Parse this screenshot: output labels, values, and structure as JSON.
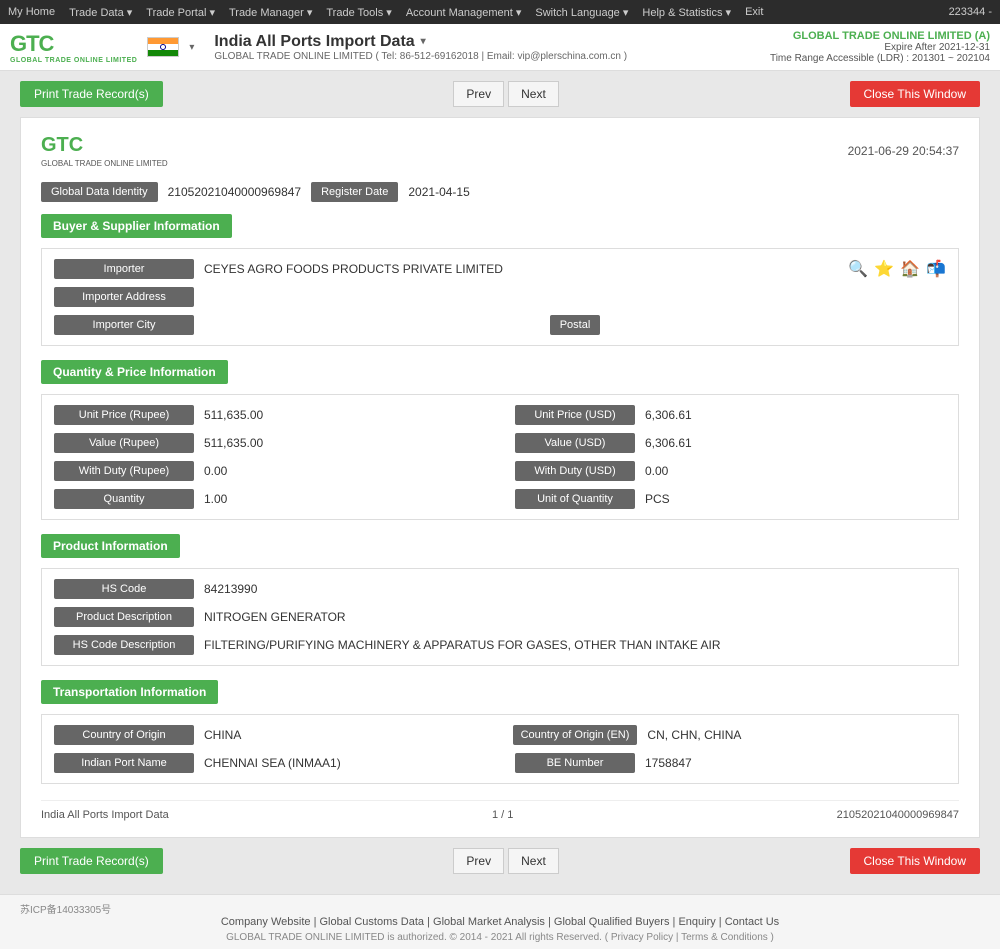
{
  "topnav": {
    "items": [
      "My Home",
      "Trade Data",
      "Trade Portal",
      "Trade Manager",
      "Trade Tools",
      "Account Management",
      "Switch Language",
      "Help & Statistics",
      "Exit"
    ],
    "account_id": "223344 -"
  },
  "header": {
    "title": "India All Ports Import Data",
    "company_info": "GLOBAL TRADE ONLINE LIMITED ( Tel: 86-512-69162018 | Email: vip@plerschina.com.cn )",
    "right_company": "GLOBAL TRADE ONLINE LIMITED (A)",
    "expire": "Expire After 2021-12-31",
    "time_range": "Time Range Accessible (LDR) : 201301 ~ 202104"
  },
  "toolbar_top": {
    "print_label": "Print Trade Record(s)",
    "prev_label": "Prev",
    "next_label": "Next",
    "close_label": "Close This Window"
  },
  "record": {
    "datetime": "2021-06-29 20:54:37",
    "global_data_identity_label": "Global Data Identity",
    "global_data_identity_value": "21052021040000969847",
    "register_date_label": "Register Date",
    "register_date_value": "2021-04-15",
    "sections": {
      "buyer_supplier": {
        "title": "Buyer & Supplier Information",
        "importer_label": "Importer",
        "importer_value": "CEYES AGRO FOODS PRODUCTS PRIVATE LIMITED",
        "importer_address_label": "Importer Address",
        "importer_address_value": "",
        "importer_city_label": "Importer City",
        "importer_city_value": "",
        "postal_label": "Postal",
        "postal_value": ""
      },
      "quantity_price": {
        "title": "Quantity & Price Information",
        "fields": [
          {
            "label": "Unit Price (Rupee)",
            "value": "511,635.00",
            "label2": "Unit Price (USD)",
            "value2": "6,306.61"
          },
          {
            "label": "Value (Rupee)",
            "value": "511,635.00",
            "label2": "Value (USD)",
            "value2": "6,306.61"
          },
          {
            "label": "With Duty (Rupee)",
            "value": "0.00",
            "label2": "With Duty (USD)",
            "value2": "0.00"
          },
          {
            "label": "Quantity",
            "value": "1.00",
            "label2": "Unit of Quantity",
            "value2": "PCS"
          }
        ]
      },
      "product": {
        "title": "Product Information",
        "hs_code_label": "HS Code",
        "hs_code_value": "84213990",
        "product_desc_label": "Product Description",
        "product_desc_value": "NITROGEN GENERATOR",
        "hs_code_desc_label": "HS Code Description",
        "hs_code_desc_value": "FILTERING/PURIFYING MACHINERY & APPARATUS FOR GASES, OTHER THAN INTAKE AIR"
      },
      "transportation": {
        "title": "Transportation Information",
        "country_origin_label": "Country of Origin",
        "country_origin_value": "CHINA",
        "country_origin_en_label": "Country of Origin (EN)",
        "country_origin_en_value": "CN, CHN, CHINA",
        "port_name_label": "Indian Port Name",
        "port_name_value": "CHENNAI SEA (INMAA1)",
        "be_number_label": "BE Number",
        "be_number_value": "1758847"
      }
    },
    "footer": {
      "source": "India All Ports Import Data",
      "pagination": "1 / 1",
      "record_id": "21052021040000969847"
    }
  },
  "toolbar_bottom": {
    "print_label": "Print Trade Record(s)",
    "prev_label": "Prev",
    "next_label": "Next",
    "close_label": "Close This Window"
  },
  "footer": {
    "icp": "苏ICP备14033305号",
    "links": [
      "Company Website",
      "Global Customs Data",
      "Global Market Analysis",
      "Global Qualified Buyers",
      "Enquiry",
      "Contact Us"
    ],
    "copyright": "GLOBAL TRADE ONLINE LIMITED is authorized. © 2014 - 2021 All rights Reserved.",
    "privacy_policy": "Privacy Policy",
    "terms": "Terms & Conditions"
  }
}
